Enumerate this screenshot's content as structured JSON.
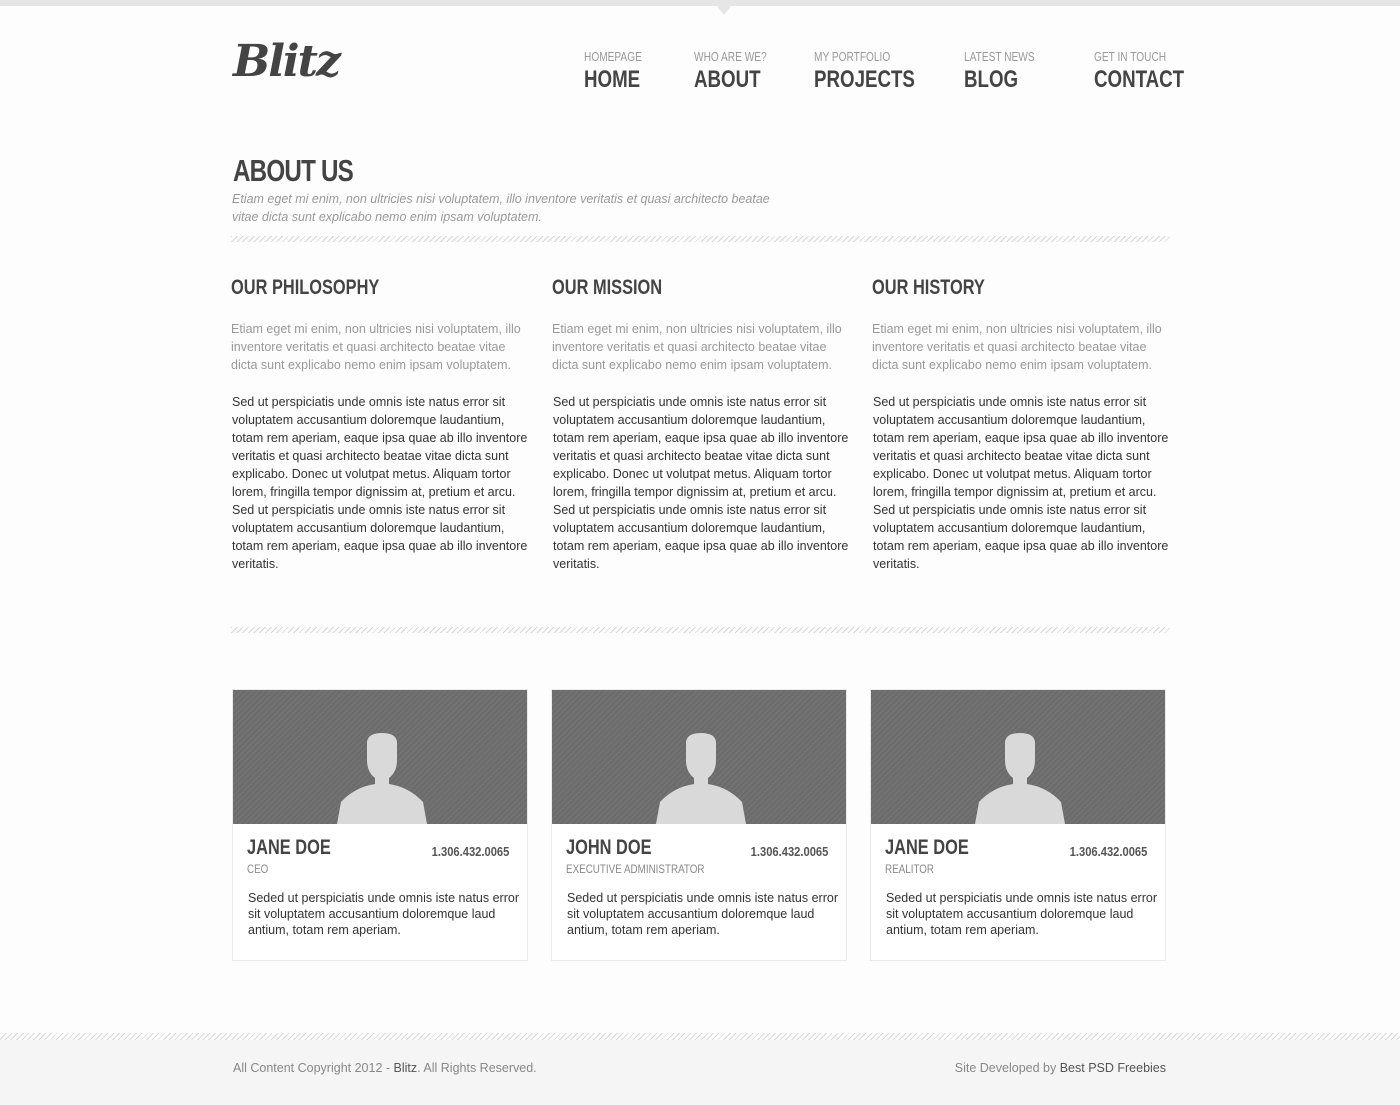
{
  "brand": {
    "logo": "Blitz"
  },
  "nav": [
    {
      "small": "Homepage",
      "big": "Home"
    },
    {
      "small": "Who are we?",
      "big": "About"
    },
    {
      "small": "My portfolio",
      "big": "Projects"
    },
    {
      "small": "Latest news",
      "big": "Blog"
    },
    {
      "small": "Get in touch",
      "big": "Contact"
    }
  ],
  "page": {
    "title": "About Us",
    "intro": "Etiam eget mi enim, non ultricies nisi voluptatem, illo inventore veritatis et quasi architecto beatae vitae dicta sunt explicabo nemo enim ipsam voluptatem."
  },
  "columns": [
    {
      "title": "Our Philosophy",
      "lead": "Etiam eget mi enim, non ultricies nisi voluptatem, illo inventore veritatis et quasi architecto beatae vitae dicta sunt explicabo nemo enim ipsam voluptatem.",
      "body": "Sed ut perspiciatis unde omnis iste natus error sit voluptatem accusantium doloremque laudantium, totam rem aperiam, eaque ipsa quae ab illo inventore veritatis et quasi architecto beatae vitae dicta sunt explicabo. Donec ut volutpat metus. Aliquam tortor lorem, fringilla tempor dignissim at, pretium et arcu. Sed ut perspiciatis unde omnis iste natus error sit voluptatem accusantium doloremque laudantium, totam rem aperiam, eaque ipsa quae ab illo inventore veritatis."
    },
    {
      "title": "Our Mission",
      "lead": "Etiam eget mi enim, non ultricies nisi voluptatem, illo inventore veritatis et quasi architecto beatae vitae dicta sunt explicabo nemo enim ipsam voluptatem.",
      "body": "Sed ut perspiciatis unde omnis iste natus error sit voluptatem accusantium doloremque laudantium, totam rem aperiam, eaque ipsa quae ab illo inventore veritatis et quasi architecto beatae vitae dicta sunt explicabo. Donec ut volutpat metus. Aliquam tortor lorem, fringilla tempor dignissim at, pretium et arcu. Sed ut perspiciatis unde omnis iste natus error sit voluptatem accusantium doloremque laudantium, totam rem aperiam, eaque ipsa quae ab illo inventore veritatis."
    },
    {
      "title": "Our History",
      "lead": "Etiam eget mi enim, non ultricies nisi voluptatem, illo inventore veritatis et quasi architecto beatae vitae dicta sunt explicabo nemo enim ipsam voluptatem.",
      "body": "Sed ut perspiciatis unde omnis iste natus error sit voluptatem accusantium doloremque laudantium, totam rem aperiam, eaque ipsa quae ab illo inventore veritatis et quasi architecto beatae vitae dicta sunt explicabo. Donec ut volutpat metus. Aliquam tortor lorem, fringilla tempor dignissim at, pretium et arcu. Sed ut perspiciatis unde omnis iste natus error sit voluptatem accusantium doloremque laudantium, totam rem aperiam, eaque ipsa quae ab illo inventore veritatis."
    }
  ],
  "team": [
    {
      "name": "Jane Doe",
      "phone": "1.306.432.0065",
      "role": "CEO",
      "bio": "Seded ut perspiciatis unde omnis iste natus error sit voluptatem accusantium doloremque laud antium, totam rem aperiam."
    },
    {
      "name": "John Doe",
      "phone": "1.306.432.0065",
      "role": "Executive Administrator",
      "bio": "Seded ut perspiciatis unde omnis iste natus error sit voluptatem accusantium doloremque laud antium, totam rem aperiam."
    },
    {
      "name": "Jane Doe",
      "phone": "1.306.432.0065",
      "role": "Realitor",
      "bio": "Seded ut perspiciatis unde omnis iste natus error sit voluptatem accusantium doloremque laud antium, totam rem aperiam."
    }
  ],
  "footer": {
    "copyright_prefix": "All Content Copyright 2012 -",
    "brand_link": "Blitz",
    "copyright_suffix": ". All Rights Reserved.",
    "developed_by": "Site Developed by",
    "developer_link": "Best PSD Freebies"
  },
  "colors": {
    "text": "#444444",
    "muted": "#999999",
    "photo_bg": "#6e6e6e",
    "silhouette": "#d9d9d9"
  },
  "icons": {
    "team_photo": "person-silhouette-icon"
  }
}
